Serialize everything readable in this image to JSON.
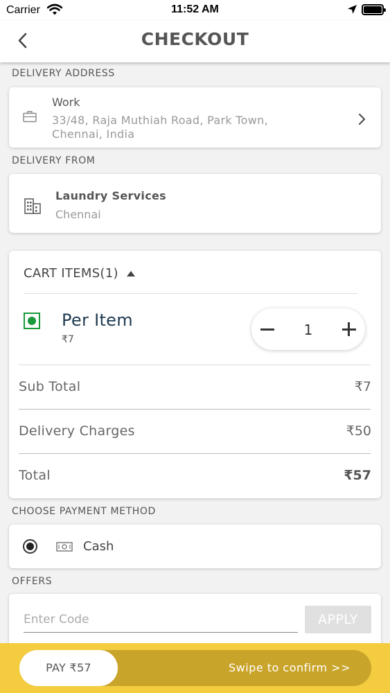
{
  "status_bar": {
    "carrier": "Carrier",
    "time": "11:52 AM"
  },
  "header": {
    "title": "CHECKOUT"
  },
  "delivery_address": {
    "section_label": "DELIVERY ADDRESS",
    "title": "Work",
    "address": "33/48, Raja Muthiah Road, Park Town, Chennai, India"
  },
  "delivery_from": {
    "section_label": "DELIVERY FROM",
    "name": "Laundry Services",
    "city": "Chennai"
  },
  "cart": {
    "title": "CART ITEMS(1)",
    "items": [
      {
        "name": "Per Item",
        "price": "₹7",
        "quantity": "1"
      }
    ],
    "summary": {
      "subtotal_label": "Sub Total",
      "subtotal_value": "₹7",
      "delivery_label": "Delivery Charges",
      "delivery_value": "₹50",
      "total_label": "Total",
      "total_value": "₹57"
    }
  },
  "payment": {
    "section_label": "CHOOSE PAYMENT METHOD",
    "method": "Cash"
  },
  "offers": {
    "section_label": "OFFERS",
    "placeholder": "Enter Code",
    "apply_label": "APPLY"
  },
  "footer": {
    "pay_label": "PAY ₹57",
    "swipe_text": "Swipe to confirm >>"
  },
  "colors": {
    "accent_yellow": "#f3cd3f",
    "swipe_track": "#c9a42a",
    "veg_green": "#1a9a3a"
  }
}
